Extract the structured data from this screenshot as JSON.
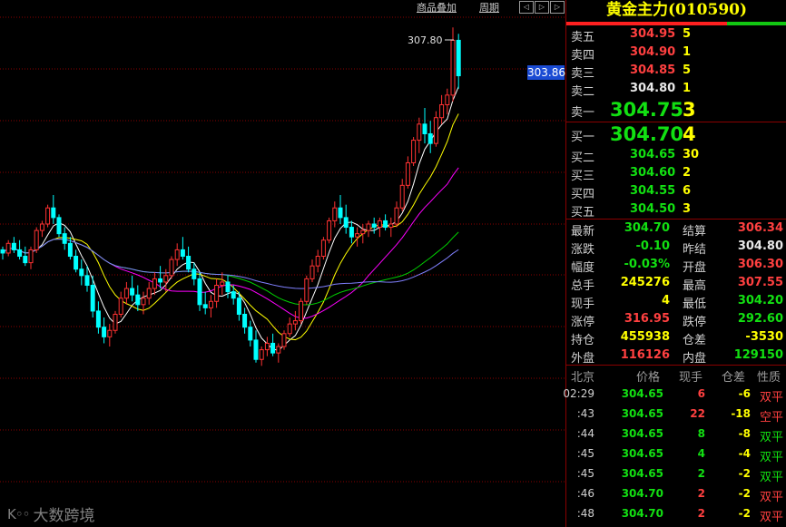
{
  "toolbar": {
    "overlay": "商品叠加",
    "period": "周期",
    "btn_left": "◁",
    "btn_right": "▷",
    "btn_r2": "▷"
  },
  "chart_labels": {
    "high_marker": "307.80",
    "last_price": "303.86"
  },
  "watermark": {
    "logo": "K◦◦",
    "text": "大数跨境"
  },
  "colors": {
    "up": "#ff3232",
    "down": "#00ffff",
    "ma5": "#ffffff",
    "ma10": "#ffff00",
    "ma20": "#ff00ff",
    "ma40": "#00d000",
    "ma60": "#8080ff",
    "grid": "#8a0000"
  },
  "chart_data": {
    "type": "candlestick",
    "ylim": [
      297.0,
      308.2
    ],
    "candles": [
      [
        300.9,
        301.0,
        300.6,
        300.8
      ],
      [
        300.8,
        301.2,
        300.7,
        301.1
      ],
      [
        301.1,
        301.3,
        300.8,
        300.9
      ],
      [
        300.9,
        301.2,
        300.6,
        300.7
      ],
      [
        300.7,
        301.0,
        300.4,
        300.5
      ],
      [
        300.5,
        301.0,
        300.3,
        300.9
      ],
      [
        300.9,
        301.6,
        300.8,
        301.5
      ],
      [
        301.5,
        301.8,
        301.3,
        301.7
      ],
      [
        301.7,
        302.3,
        301.6,
        302.2
      ],
      [
        302.2,
        302.6,
        301.7,
        301.9
      ],
      [
        301.9,
        302.0,
        301.3,
        301.4
      ],
      [
        301.4,
        301.6,
        300.9,
        301.1
      ],
      [
        301.1,
        301.3,
        300.6,
        300.7
      ],
      [
        300.7,
        300.9,
        300.2,
        300.3
      ],
      [
        300.3,
        300.6,
        299.8,
        300.1
      ],
      [
        300.1,
        300.4,
        299.6,
        299.8
      ],
      [
        299.8,
        300.1,
        298.8,
        299.0
      ],
      [
        299.0,
        299.3,
        298.3,
        298.5
      ],
      [
        298.5,
        298.8,
        298.0,
        298.2
      ],
      [
        298.2,
        298.6,
        297.9,
        298.4
      ],
      [
        298.4,
        299.0,
        298.3,
        298.9
      ],
      [
        298.9,
        299.6,
        298.8,
        299.4
      ],
      [
        299.4,
        299.9,
        299.2,
        299.7
      ],
      [
        299.7,
        300.1,
        299.3,
        299.5
      ],
      [
        299.5,
        299.8,
        299.0,
        299.2
      ],
      [
        299.2,
        299.6,
        298.9,
        299.4
      ],
      [
        299.4,
        299.9,
        299.2,
        299.7
      ],
      [
        299.7,
        300.2,
        299.5,
        300.0
      ],
      [
        300.0,
        300.4,
        299.7,
        299.9
      ],
      [
        299.9,
        300.3,
        299.6,
        300.1
      ],
      [
        300.1,
        300.7,
        300.0,
        300.6
      ],
      [
        300.6,
        301.1,
        300.4,
        300.9
      ],
      [
        300.9,
        301.3,
        300.6,
        300.7
      ],
      [
        300.7,
        301.0,
        300.2,
        300.3
      ],
      [
        300.3,
        300.5,
        299.8,
        300.0
      ],
      [
        300.0,
        300.2,
        299.0,
        299.2
      ],
      [
        299.2,
        299.6,
        298.9,
        299.1
      ],
      [
        299.1,
        299.5,
        298.8,
        299.3
      ],
      [
        299.3,
        300.0,
        299.1,
        299.8
      ],
      [
        299.8,
        300.2,
        299.5,
        299.9
      ],
      [
        299.9,
        300.1,
        299.4,
        299.6
      ],
      [
        299.6,
        299.8,
        299.2,
        299.4
      ],
      [
        299.4,
        299.6,
        298.7,
        298.9
      ],
      [
        298.9,
        299.1,
        298.3,
        298.5
      ],
      [
        298.5,
        298.7,
        297.9,
        298.1
      ],
      [
        298.1,
        298.4,
        297.4,
        297.5
      ],
      [
        297.5,
        297.9,
        297.3,
        297.8
      ],
      [
        297.8,
        298.2,
        297.6,
        298.0
      ],
      [
        298.0,
        298.3,
        297.6,
        297.7
      ],
      [
        297.7,
        298.0,
        297.4,
        297.9
      ],
      [
        297.9,
        298.4,
        297.8,
        298.3
      ],
      [
        298.3,
        298.8,
        298.2,
        298.6
      ],
      [
        298.6,
        299.0,
        298.4,
        298.7
      ],
      [
        298.7,
        299.4,
        298.6,
        299.3
      ],
      [
        299.3,
        300.1,
        299.2,
        300.0
      ],
      [
        300.0,
        300.6,
        299.9,
        300.4
      ],
      [
        300.4,
        300.9,
        300.2,
        300.7
      ],
      [
        300.7,
        301.3,
        300.6,
        301.2
      ],
      [
        301.2,
        301.9,
        301.1,
        301.8
      ],
      [
        301.8,
        302.4,
        301.6,
        302.2
      ],
      [
        302.2,
        302.6,
        301.7,
        301.9
      ],
      [
        301.9,
        302.3,
        301.4,
        301.6
      ],
      [
        301.6,
        301.8,
        301.1,
        301.3
      ],
      [
        301.3,
        301.6,
        301.0,
        301.4
      ],
      [
        301.4,
        301.7,
        301.1,
        301.5
      ],
      [
        301.5,
        301.8,
        301.3,
        301.7
      ],
      [
        301.7,
        301.9,
        301.4,
        301.6
      ],
      [
        301.6,
        301.9,
        301.3,
        301.8
      ],
      [
        301.8,
        302.0,
        301.5,
        301.6
      ],
      [
        301.6,
        301.9,
        301.3,
        301.7
      ],
      [
        301.7,
        302.4,
        301.6,
        302.2
      ],
      [
        302.2,
        303.1,
        302.1,
        302.9
      ],
      [
        302.9,
        303.8,
        302.8,
        303.6
      ],
      [
        303.6,
        304.4,
        303.5,
        304.3
      ],
      [
        304.3,
        305.0,
        303.9,
        304.8
      ],
      [
        304.8,
        305.3,
        304.2,
        304.5
      ],
      [
        304.5,
        304.9,
        303.9,
        304.2
      ],
      [
        304.2,
        305.2,
        304.1,
        305.0
      ],
      [
        305.0,
        305.7,
        304.8,
        305.4
      ],
      [
        305.4,
        305.9,
        305.1,
        305.7
      ],
      [
        305.7,
        307.8,
        305.5,
        307.4
      ],
      [
        307.4,
        307.6,
        305.9,
        306.3
      ]
    ],
    "ma": {
      "ma5_start": 300.8,
      "ma5_end": 305.6,
      "ma10_end": 305.0,
      "ma20_end": 303.0,
      "ma40_end": 300.8,
      "ma60_end": 300.4
    }
  },
  "quote": {
    "title": "黄金主力(010590)",
    "ratio_red": 73,
    "asks": [
      {
        "label": "卖五",
        "price": "304.95",
        "vol": "5"
      },
      {
        "label": "卖四",
        "price": "304.90",
        "vol": "1"
      },
      {
        "label": "卖三",
        "price": "304.85",
        "vol": "5"
      },
      {
        "label": "卖二",
        "price": "304.80",
        "vol": "1"
      },
      {
        "label": "卖一",
        "price": "304.75",
        "vol": "3"
      }
    ],
    "bids": [
      {
        "label": "买一",
        "price": "304.70",
        "vol": "4"
      },
      {
        "label": "买二",
        "price": "304.65",
        "vol": "30"
      },
      {
        "label": "买三",
        "price": "304.60",
        "vol": "2"
      },
      {
        "label": "买四",
        "price": "304.55",
        "vol": "6"
      },
      {
        "label": "买五",
        "price": "304.50",
        "vol": "3"
      }
    ],
    "stats": [
      {
        "l1": "最新",
        "v1": "304.70",
        "c1": "grn",
        "l2": "结算",
        "v2": "306.34",
        "c2": "red"
      },
      {
        "l1": "涨跌",
        "v1": "-0.10",
        "c1": "grn",
        "l2": "昨结",
        "v2": "304.80",
        "c2": "wht"
      },
      {
        "l1": "幅度",
        "v1": "-0.03%",
        "c1": "grn",
        "l2": "开盘",
        "v2": "306.30",
        "c2": "red"
      },
      {
        "l1": "总手",
        "v1": "245276",
        "c1": "yel",
        "l2": "最高",
        "v2": "307.55",
        "c2": "red"
      },
      {
        "l1": "现手",
        "v1": "4",
        "c1": "yel",
        "l2": "最低",
        "v2": "304.20",
        "c2": "grn"
      },
      {
        "l1": "涨停",
        "v1": "316.95",
        "c1": "red",
        "l2": "跌停",
        "v2": "292.60",
        "c2": "grn"
      },
      {
        "l1": "持仓",
        "v1": "455938",
        "c1": "yel",
        "l2": "仓差",
        "v2": "-3530",
        "c2": "yel"
      },
      {
        "l1": "外盘",
        "v1": "116126",
        "c1": "red",
        "l2": "内盘",
        "v2": "129150",
        "c2": "grn"
      }
    ],
    "tick_header": {
      "time": "北京",
      "price": "价格",
      "vol": "现手",
      "diff": "仓差",
      "nature": "性质"
    },
    "ticks": [
      {
        "time": "02:29",
        "price": "304.65",
        "vol": "6",
        "vc": "red",
        "diff": "-6",
        "nature": "双平",
        "nc": "red"
      },
      {
        "time": ":43",
        "price": "304.65",
        "vol": "22",
        "vc": "red",
        "diff": "-18",
        "nature": "空平",
        "nc": "red"
      },
      {
        "time": ":44",
        "price": "304.65",
        "vol": "8",
        "vc": "grn",
        "diff": "-8",
        "nature": "双平",
        "nc": "grn"
      },
      {
        "time": ":45",
        "price": "304.65",
        "vol": "4",
        "vc": "grn",
        "diff": "-4",
        "nature": "双平",
        "nc": "grn"
      },
      {
        "time": ":45",
        "price": "304.65",
        "vol": "2",
        "vc": "grn",
        "diff": "-2",
        "nature": "双平",
        "nc": "grn"
      },
      {
        "time": ":46",
        "price": "304.70",
        "vol": "2",
        "vc": "red",
        "diff": "-2",
        "nature": "双平",
        "nc": "red"
      },
      {
        "time": ":48",
        "price": "304.70",
        "vol": "2",
        "vc": "red",
        "diff": "-2",
        "nature": "双平",
        "nc": "red"
      }
    ]
  }
}
